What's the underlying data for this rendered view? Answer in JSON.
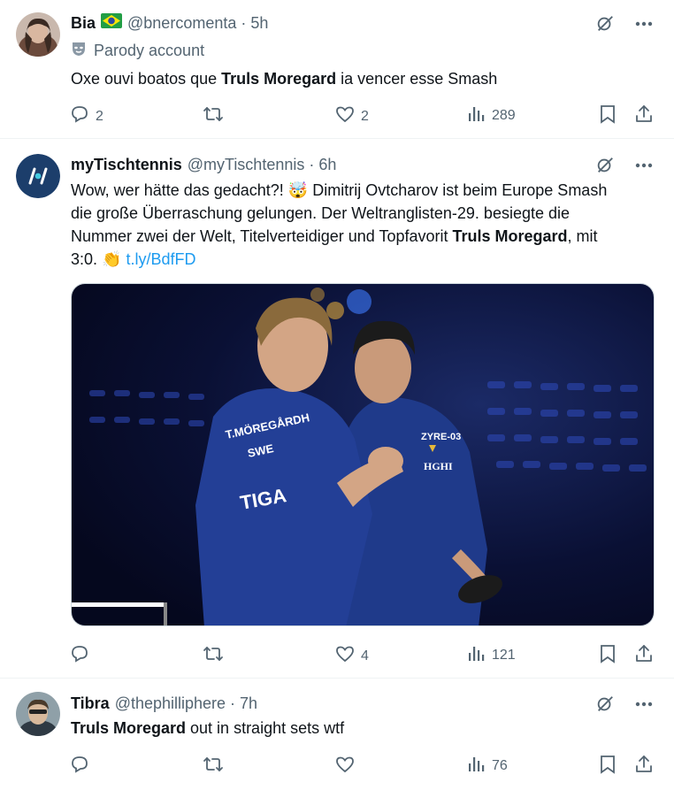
{
  "tweets": [
    {
      "name": "Bia",
      "flag": "brazil-flag",
      "handle": "@bnercomenta",
      "sep": "·",
      "time": "5h",
      "parody_label": "Parody account",
      "text_pre": "Oxe ouvi boatos que ",
      "text_bold": "Truls Moregard",
      "text_post": " ia vencer esse Smash",
      "replies": "2",
      "retweets": "",
      "likes": "2",
      "views": "289"
    },
    {
      "name": "myTischtennis",
      "handle": "@myTischtennis",
      "sep": "·",
      "time": "6h",
      "text_line1_pre": "Wow, wer hätte das gedacht?! ",
      "emoji1": "🤯",
      "text_line1_post": " Dimitrij Ovtcharov ist beim Europe Smash",
      "text_line2": "die große Überraschung gelungen. Der Weltranglisten-29. besiegte die",
      "text_line3_pre": "Nummer zwei der Welt, Titelverteidiger und Topfavorit ",
      "text_line3_bold": "Truls Moregard",
      "text_line3_post": ", mit",
      "text_line4_pre": "3:0. ",
      "emoji2": "👏",
      "link": "t.ly/BdfFD",
      "media_jersey_left": "T.MÖREGÅRDH",
      "media_jersey_left2": "SWE",
      "media_brand": "TIGA",
      "media_jersey_right": "ZYRE-03",
      "media_sponsor": "HGHI",
      "replies": "",
      "retweets": "",
      "likes": "4",
      "views": "121"
    },
    {
      "name": "Tibra",
      "handle": "@thephilliphere",
      "sep": "·",
      "time": "7h",
      "text_bold": "Truls Moregard",
      "text_post": " out in straight sets wtf",
      "replies": "",
      "retweets": "",
      "likes": "",
      "views": "76"
    }
  ],
  "colors": {
    "text": "#0f1419",
    "secondary": "#536471",
    "link": "#1d9bf0",
    "divider": "#eff3f4",
    "jersey": "#1f3a8a"
  }
}
